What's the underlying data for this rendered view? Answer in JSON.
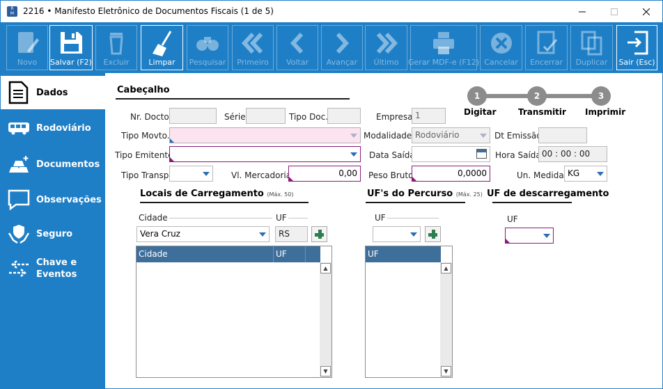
{
  "window": {
    "title": "2216 • Manifesto Eletrônico de Documentos Fiscais (1 de 5)"
  },
  "toolbar": {
    "novo": "Novo",
    "salvar": "Salvar (F2)",
    "excluir": "Excluir",
    "limpar": "Limpar",
    "pesquisar": "Pesquisar",
    "primeiro": "Primeiro",
    "voltar": "Voltar",
    "avancar": "Avançar",
    "ultimo": "Último",
    "gerar": "Gerar MDF-e (F12)",
    "cancelar": "Cancelar",
    "encerrar": "Encerrar",
    "duplicar": "Duplicar",
    "sair": "Sair (Esc)"
  },
  "sidebar": {
    "dados": "Dados",
    "rodoviario": "Rodoviário",
    "documentos": "Documentos",
    "observacoes": "Observações",
    "seguro": "Seguro",
    "chave_line1": "Chave e",
    "chave_line2": "Eventos"
  },
  "cabecalho": {
    "title": "Cabeçalho",
    "nr_docto_label": "Nr. Docto",
    "serie_label": "Série",
    "tipo_doc_label": "Tipo Doc.",
    "empresa_label": "Empresa",
    "empresa_value": "1",
    "tipo_movto_label": "Tipo Movto.",
    "modalidade_label": "Modalidade",
    "modalidade_value": "Rodoviário",
    "dt_emissao_label": "Dt Emissão",
    "tipo_emitente_label": "Tipo Emitente",
    "data_saida_label": "Data Saída",
    "hora_saida_label": "Hora Saída",
    "hora_saida_value": "00 : 00 : 00",
    "tipo_transp_label": "Tipo Transp.",
    "vl_mercadoria_label": "Vl. Mercadoria",
    "vl_mercadoria_value": "0,00",
    "peso_bruto_label": "Peso Bruto",
    "peso_bruto_value": "0,0000",
    "un_medida_label": "Un. Medida",
    "un_medida_value": "KG"
  },
  "steps": [
    {
      "number": "1",
      "label": "Digitar"
    },
    {
      "number": "2",
      "label": "Transmitir"
    },
    {
      "number": "3",
      "label": "Imprimir"
    }
  ],
  "carregamento": {
    "title": "Locais de Carregamento",
    "subtitle": "(Máx. 50)",
    "cidade_label": "Cidade",
    "uf_label": "UF",
    "cidade_value": "Vera Cruz",
    "uf_value": "RS",
    "grid_headers": [
      "Cidade",
      "UF"
    ]
  },
  "percurso": {
    "title": "UF's do Percurso",
    "subtitle": "(Máx. 25)",
    "uf_label": "UF",
    "grid_headers": [
      "UF"
    ]
  },
  "descarregamento": {
    "title": "UF de descarregamento",
    "uf_label": "UF"
  }
}
